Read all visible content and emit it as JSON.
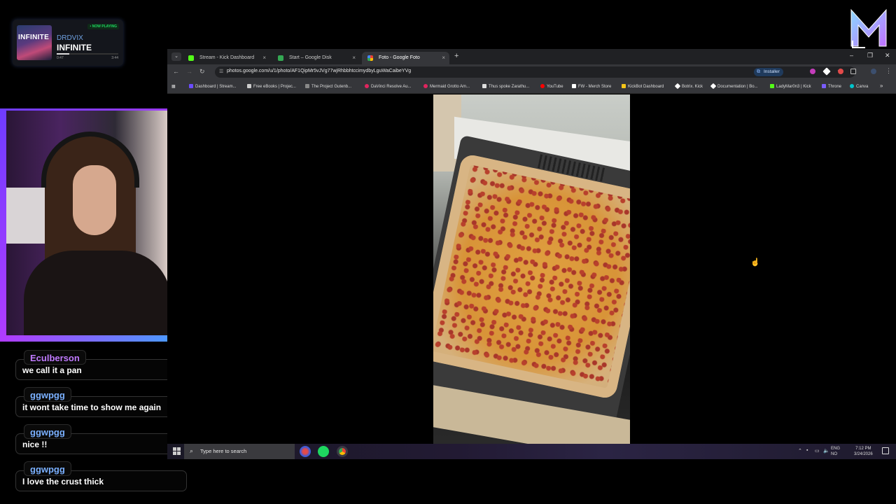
{
  "now_playing": {
    "badge": "• NOW PLAYING",
    "cover_text": "INFINITE",
    "artist": "DRDVIX",
    "title": "INFINITE",
    "elapsed": "0:47",
    "duration": "3:44",
    "progress": 0.21
  },
  "chat": [
    {
      "user": "Eculberson",
      "user_color": "#c07aff",
      "message": "we call it a pan"
    },
    {
      "user": "ggwpgg",
      "user_color": "#7ab0ff",
      "message": "it wont take time to show me again"
    },
    {
      "user": "ggwpgg",
      "user_color": "#7ab0ff",
      "message": "nice !!"
    },
    {
      "user": "ggwpgg",
      "user_color": "#7ab0ff",
      "message": "I love the crust thick"
    }
  ],
  "browser": {
    "tabs": [
      {
        "label": "Stream - Kick Dashboard",
        "favicon_color": "#53fc18",
        "close": "×"
      },
      {
        "label": "Start – Google Disk",
        "favicon_color": "#34a853",
        "close": "×"
      },
      {
        "label": "Foto - Google Foto",
        "favicon_color": "#fbbc04",
        "close": "×"
      }
    ],
    "new_tab": "+",
    "window_controls": {
      "minimize": "–",
      "restore": "❐",
      "close": "✕"
    },
    "nav": {
      "back": "←",
      "forward": "→",
      "reload": "↻"
    },
    "url": "photos.google.com/u/1/photo/AF1QipMr5vJVg77wjRhbbhtccimydbyLguWaCaibeYVg",
    "install_label": "Installer",
    "bookmarks": [
      {
        "label": "Dashboard | Stream...",
        "color": "#6b4cff"
      },
      {
        "label": "Free eBooks | Projec...",
        "color": "#cccccc"
      },
      {
        "label": "The Project Gutenb...",
        "color": "#888888"
      },
      {
        "label": "DaVinci Resolve Au...",
        "color": "#e0245e"
      },
      {
        "label": "Mermaid Grotto Am...",
        "color": "#e0245e"
      },
      {
        "label": "Thus spoke Zarathu...",
        "color": "#dddddd"
      },
      {
        "label": "YouTube",
        "color": "#ff0000"
      },
      {
        "label": "FW - Merch Store",
        "color": "#ffffff"
      },
      {
        "label": "KickBot Dashboard",
        "color": "#f5c518"
      },
      {
        "label": "Botrix. Kick",
        "color": "#ffffff"
      },
      {
        "label": "Documentation | Bo...",
        "color": "#ffffff"
      },
      {
        "label": "LadyMar0n3 | Kick",
        "color": "#53fc18"
      },
      {
        "label": "Throne",
        "color": "#7a5cff"
      },
      {
        "label": "Canva",
        "color": "#00c4cc"
      }
    ],
    "bookmarks_more": "»"
  },
  "taskbar": {
    "search_placeholder": "Type here to search",
    "lang_top": "ENG",
    "lang_bottom": "NO",
    "time": "7:12 PM",
    "date": "3/24/2026"
  }
}
